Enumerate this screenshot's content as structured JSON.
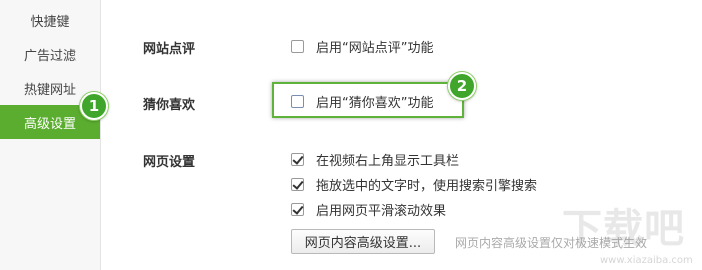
{
  "sidebar": {
    "items": [
      {
        "label": "快捷键",
        "active": false
      },
      {
        "label": "广告过滤",
        "active": false
      },
      {
        "label": "热键网址",
        "active": false
      },
      {
        "label": "高级设置",
        "active": true
      }
    ]
  },
  "markers": {
    "one": "1",
    "two": "2"
  },
  "sections": {
    "site_review": {
      "title": "网站点评",
      "option": {
        "label": "启用“网站点评”功能",
        "checked": false
      }
    },
    "guess": {
      "title": "猜你喜欢",
      "option": {
        "label": "启用“猜你喜欢”功能",
        "checked": false
      }
    },
    "page": {
      "title": "网页设置",
      "options": [
        {
          "label": "在视频右上角显示工具栏",
          "checked": true
        },
        {
          "label": "拖放选中的文字时，使用搜索引擎搜索",
          "checked": true
        },
        {
          "label": "启用网页平滑滚动效果",
          "checked": true
        }
      ],
      "advanced_button": "网页内容高级设置...",
      "note": "网页内容高级设置仅对极速模式生效"
    }
  },
  "watermark": {
    "big": "下载吧",
    "small": "www.xiazaiba.com"
  },
  "colors": {
    "accent": "#5aad2e",
    "marker": "#3fa62b"
  }
}
